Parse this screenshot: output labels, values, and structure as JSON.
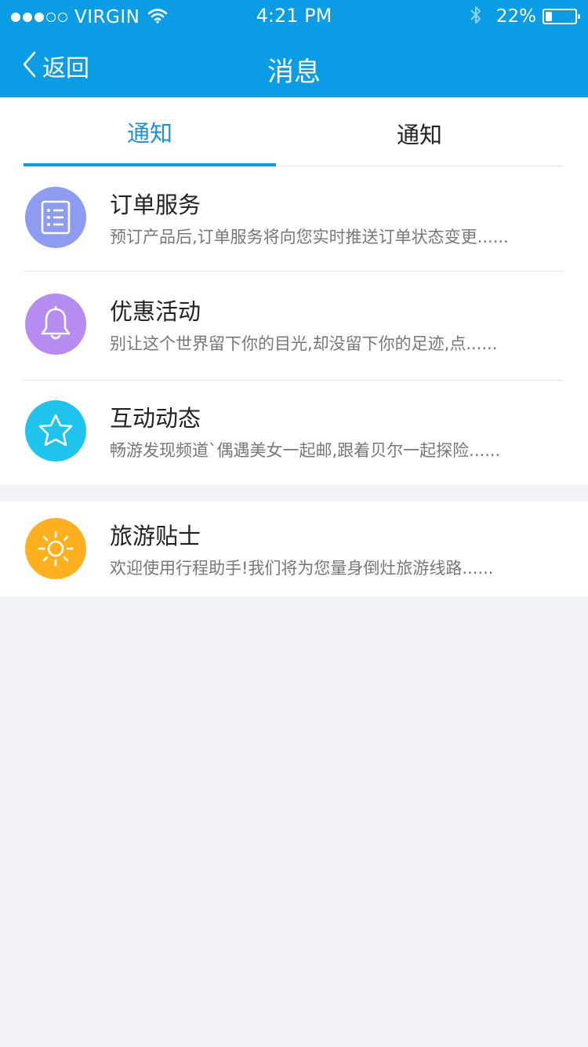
{
  "status_bar": {
    "signal_dots_full": 3,
    "signal_dots_empty": 2,
    "carrier": "VIRGIN",
    "time": "4:21 PM",
    "battery_percent": "22%",
    "battery_level": 0.22,
    "icons": [
      "wifi-icon",
      "bluetooth-icon",
      "battery-icon"
    ]
  },
  "nav": {
    "back_label": "返回",
    "title": "消息"
  },
  "tabs": [
    {
      "label": "通知",
      "active": true
    },
    {
      "label": "通知",
      "active": false
    }
  ],
  "messages": [
    {
      "title": "订单服务",
      "desc": "预订产品后,订单服务将向您实时推送订单状态变更......",
      "icon": "order-list-icon",
      "color": "#8d9cf0"
    },
    {
      "title": "优惠活动",
      "desc": "别让这个世界留下你的目光,却没留下你的足迹,点......",
      "icon": "bell-icon",
      "color": "#b78cf0"
    },
    {
      "title": "互动动态",
      "desc": "畅游发现频道`偶遇美女一起邮,跟着贝尔一起探险......",
      "icon": "star-icon",
      "color": "#1fc4ec"
    }
  ],
  "tips": [
    {
      "title": "旅游贴士",
      "desc": "欢迎使用行程助手!我们将为您量身倒灶旅游线路......",
      "icon": "sun-icon",
      "color": "#ffb01f"
    }
  ],
  "colors": {
    "header_bg": "#0a9de6",
    "active_tab": "#1e8fd9",
    "page_bg": "#f0f2f5"
  }
}
